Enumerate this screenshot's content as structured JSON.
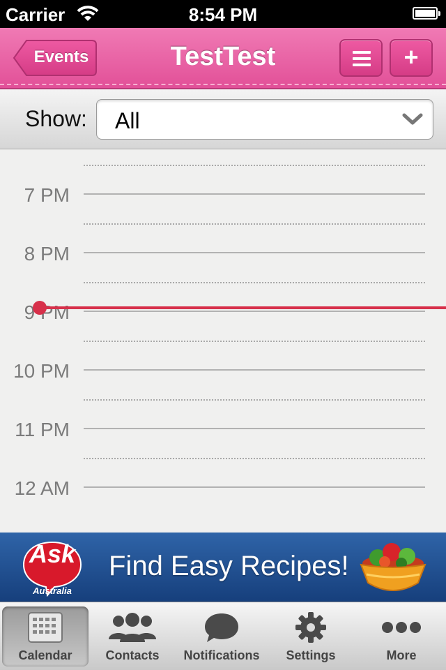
{
  "status_bar": {
    "carrier": "Carrier",
    "time": "8:54 PM"
  },
  "nav": {
    "back_label": "Events",
    "title": "TestTest",
    "add_label": "+"
  },
  "filter": {
    "label": "Show:",
    "selected": "All"
  },
  "calendar": {
    "hours": [
      "7 PM",
      "8 PM",
      "9 PM",
      "10 PM",
      "11 PM",
      "12 AM"
    ],
    "current_time": "8:54 PM",
    "now_color": "#d7304a"
  },
  "ad": {
    "brand": "Ask",
    "sub": "Australia",
    "headline": "Find Easy Recipes!"
  },
  "tabs": [
    {
      "label": "Calendar",
      "icon": "calendar-icon",
      "selected": true
    },
    {
      "label": "Contacts",
      "icon": "contacts-icon",
      "selected": false
    },
    {
      "label": "Notifications",
      "icon": "speech-bubble-icon",
      "selected": false
    },
    {
      "label": "Settings",
      "icon": "gear-icon",
      "selected": false
    },
    {
      "label": "More",
      "icon": "more-dots-icon",
      "selected": false
    }
  ],
  "colors": {
    "nav_pink": "#e25098",
    "ad_blue": "#2f64a8"
  }
}
